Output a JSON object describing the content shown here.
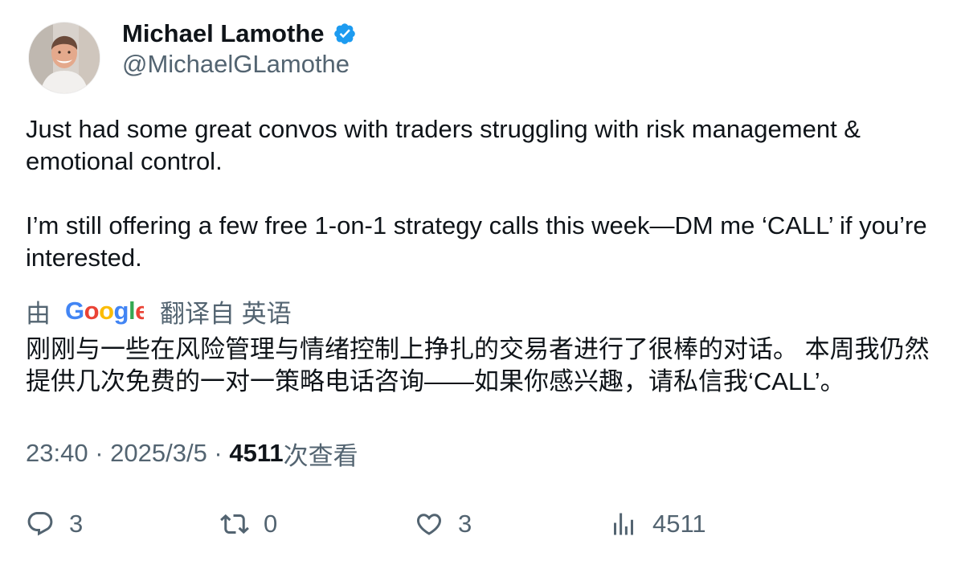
{
  "author": {
    "display_name": "Michael Lamothe",
    "handle": "@MichaelGLamothe",
    "verified_icon": "verified-badge-icon",
    "verified_color": "#1d9bf0"
  },
  "tweet": {
    "paragraphs": [
      "Just had some great convos with traders struggling with risk management & emotional control.",
      "I’m still offering a few free 1-on-1 strategy calls this week—DM me ‘CALL’ if you’re interested."
    ]
  },
  "translation": {
    "prefix": "由",
    "provider_logo": "google-logo",
    "suffix": "翻译自 英语",
    "text": "刚刚与一些在风险管理与情绪控制上挣扎的交易者进行了很棒的对话。 本周我仍然提供几次免费的一对一策略电话咨询——如果你感兴趣，请私信我‘CALL’。"
  },
  "meta": {
    "time": "23:40",
    "separator": " · ",
    "date": "2025/3/5",
    "views_count": "4511",
    "views_label": "次查看"
  },
  "actions": {
    "replies": "3",
    "reposts": "0",
    "likes": "3",
    "views": "4511"
  },
  "colors": {
    "text_primary": "#0f1419",
    "text_secondary": "#536471"
  }
}
